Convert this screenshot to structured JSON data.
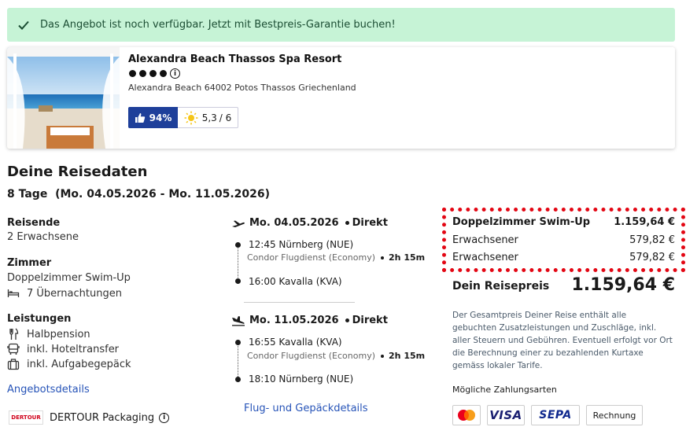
{
  "banner": {
    "text": "Das Angebot ist noch verfügbar. Jetzt mit Bestpreis-Garantie buchen!"
  },
  "hotel": {
    "name": "Alexandra Beach Thassos Spa Resort",
    "stars": 4,
    "address": "Alexandra Beach 64002 Potos Thassos Griechenland",
    "recommendation": "94%",
    "score": "5,3",
    "score_max": "/ 6"
  },
  "travel": {
    "title": "Deine Reisedaten",
    "duration": "8 Tage  (Mo. 04.05.2026 - Mo. 11.05.2026)",
    "travelers_label": "Reisende",
    "travelers": "2 Erwachsene",
    "room_label": "Zimmer",
    "room": "Doppelzimmer Swim-Up",
    "nights": "7 Übernachtungen",
    "services_label": "Leistungen",
    "services": [
      "Halbpension",
      "inkl. Hoteltransfer",
      "inkl. Aufgabegepäck"
    ],
    "offer_link": "Angebotsdetails",
    "operator": "DERTOUR Packaging",
    "operator_logo": "DERTOUR"
  },
  "flights": {
    "outbound": {
      "date": "Mo. 04.05.2026",
      "type": "Direkt",
      "dep_time": "12:45 Nürnberg (NUE)",
      "airline": "Condor Flugdienst (Economy)",
      "duration": "2h 15m",
      "arr_time": "16:00 Kavalla (KVA)"
    },
    "inbound": {
      "date": "Mo. 11.05.2026",
      "type": "Direkt",
      "dep_time": "16:55 Kavalla (KVA)",
      "airline": "Condor Flugdienst (Economy)",
      "duration": "2h 15m",
      "arr_time": "18:10 Nürnberg (NUE)"
    },
    "link": "Flug- und Gepäckdetails"
  },
  "price": {
    "room": "Doppelzimmer Swim-Up",
    "room_total": "1.159,64 €",
    "persons": [
      {
        "label": "Erwachsener",
        "amount": "579,82 €"
      },
      {
        "label": "Erwachsener",
        "amount": "579,82 €"
      }
    ],
    "total_label": "Dein Reisepreis",
    "total": "1.159,64 €",
    "note": "Der Gesamtpreis Deiner Reise enthält alle gebuchten Zusatzleistungen und Zuschläge, inkl. aller Steuern und Gebühren. Eventuell erfolgt vor Ort die Berechnung einer zu bezahlenden Kurtaxe gemäss lokaler Tarife.",
    "payment_label": "Mögliche Zahlungsarten",
    "payments": [
      "mastercard",
      "VISA",
      "SEPA",
      "Rechnung"
    ]
  },
  "colors": {
    "accent": "#1e3f9a",
    "link": "#2754b8",
    "banner_bg": "#c6f3d6",
    "highlight": "#e30613"
  }
}
